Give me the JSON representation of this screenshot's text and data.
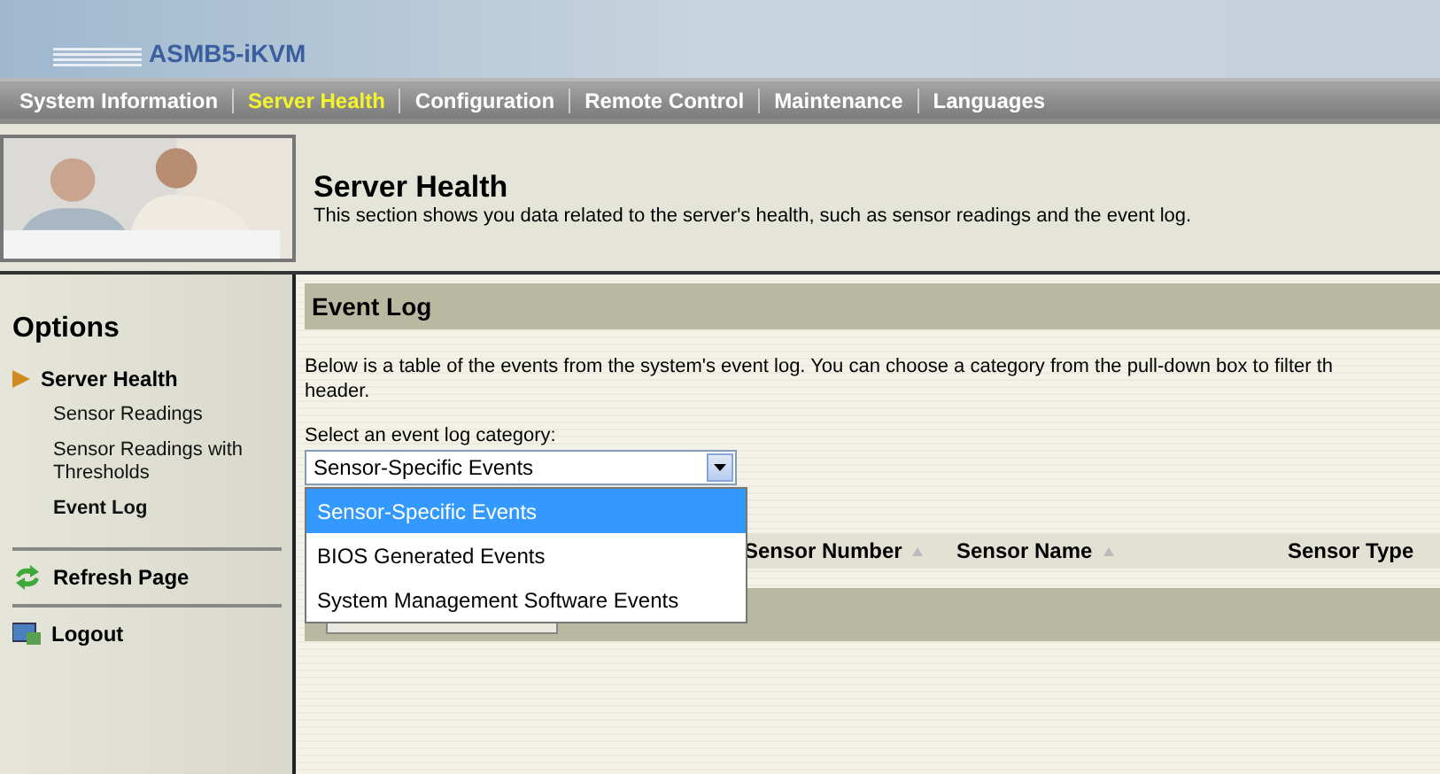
{
  "logo": {
    "text": "ASMB5-iKVM"
  },
  "nav": [
    {
      "label": "System Information",
      "selected": false
    },
    {
      "label": "Server Health",
      "selected": true
    },
    {
      "label": "Configuration",
      "selected": false
    },
    {
      "label": "Remote Control",
      "selected": false
    },
    {
      "label": "Maintenance",
      "selected": false
    },
    {
      "label": "Languages",
      "selected": false
    }
  ],
  "banner": {
    "title": "Server Health",
    "subtitle": "This section shows you data related to the server's health, such as sensor readings and the event log."
  },
  "sidebar": {
    "heading": "Options",
    "section": "Server Health",
    "items": [
      {
        "label": "Sensor Readings",
        "selected": false
      },
      {
        "label": "Sensor Readings with Thresholds",
        "selected": false
      },
      {
        "label": "Event Log",
        "selected": true
      }
    ],
    "actions": [
      {
        "label": "Refresh Page",
        "kind": "refresh"
      },
      {
        "label": "Logout",
        "kind": "logout"
      }
    ]
  },
  "main": {
    "title": "Event Log",
    "description": [
      "Below is a table of the events from the system's event log. You can choose a category from the pull-down box to filter th",
      "header."
    ],
    "select_label": "Select an event log category:",
    "select_value": "Sensor-Specific Events",
    "options": [
      {
        "label": "Sensor-Specific Events",
        "selected": true
      },
      {
        "label": "BIOS Generated Events",
        "selected": false
      },
      {
        "label": "System Management Software Events",
        "selected": false
      }
    ],
    "columns": [
      "Sensor Number",
      "Sensor Name",
      "Sensor Type"
    ]
  }
}
